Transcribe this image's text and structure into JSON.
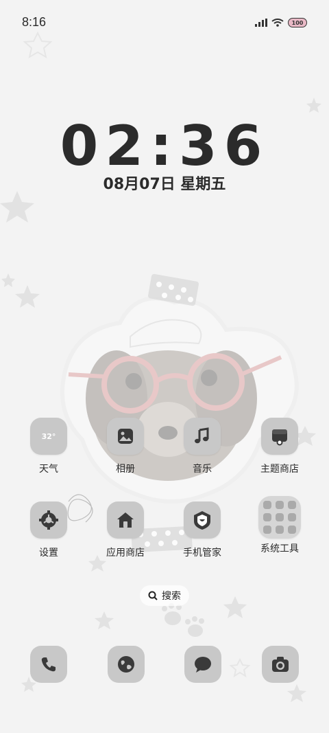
{
  "status_bar": {
    "time": "8:16",
    "battery": "100",
    "icons": [
      "signal-icon",
      "wifi-icon",
      "battery-icon"
    ]
  },
  "lock": {
    "clock": "02:36",
    "date": "08月07日 星期五"
  },
  "apps_row1": [
    {
      "label": "天气",
      "icon": "weather-icon",
      "icon_text": "32°"
    },
    {
      "label": "相册",
      "icon": "gallery-icon"
    },
    {
      "label": "音乐",
      "icon": "music-icon"
    },
    {
      "label": "主题商店",
      "icon": "theme-store-icon"
    }
  ],
  "apps_row2": [
    {
      "label": "设置",
      "icon": "settings-icon"
    },
    {
      "label": "应用商店",
      "icon": "app-store-icon"
    },
    {
      "label": "手机管家",
      "icon": "phone-manager-icon"
    },
    {
      "label": "系统工具",
      "icon": "system-tools-folder-icon"
    }
  ],
  "search": {
    "label": "搜索",
    "icon": "search-icon"
  },
  "dock": [
    {
      "icon": "phone-icon"
    },
    {
      "icon": "browser-icon"
    },
    {
      "icon": "messages-icon"
    },
    {
      "icon": "camera-icon"
    }
  ],
  "colors": {
    "background": "#f3f3f3",
    "icon_tile": "#c8c8c8",
    "icon_glyph": "#3a3a3a",
    "battery_fill": "#e9b9c6"
  }
}
